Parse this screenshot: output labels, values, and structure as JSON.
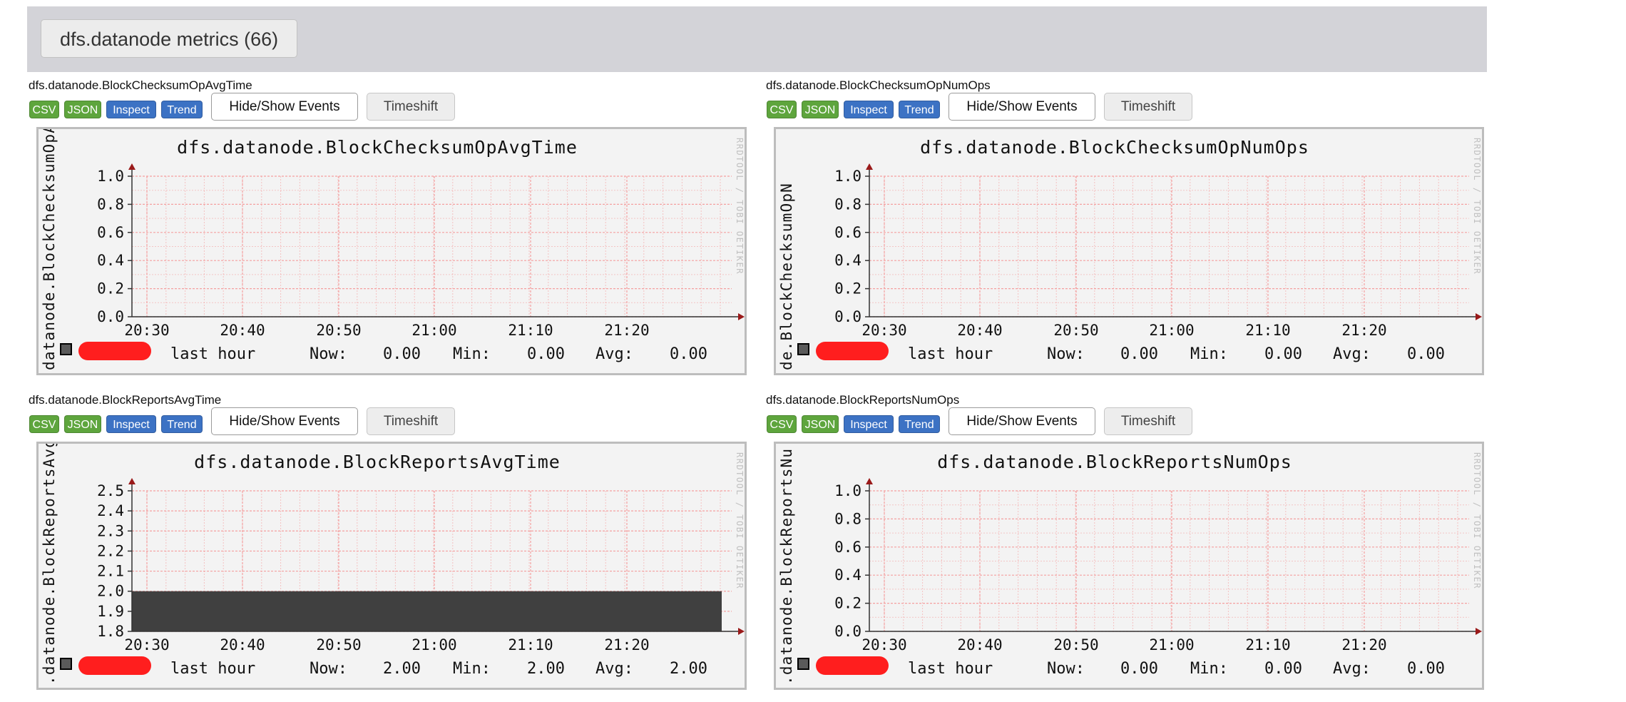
{
  "section": {
    "label": "dfs.datanode metrics (66)"
  },
  "buttons": {
    "csv": "CSV",
    "json": "JSON",
    "inspect": "Inspect",
    "trend": "Trend",
    "events": "Hide/Show Events",
    "timeshift": "Timeshift"
  },
  "footer": {
    "period": "last hour",
    "now_label": "Now:",
    "min_label": "Min:",
    "avg_label": "Avg:"
  },
  "watermark": "RRDTOOL / TOBI OETIKER",
  "colors": {
    "grid": "#f4a0a0",
    "axis": "#9a1a1a",
    "area": "#404040",
    "redaction": "#ff1e1e"
  },
  "panels": [
    {
      "metric": "dfs.datanode.BlockChecksumOpAvgTime",
      "ylabel": "datanode.BlockChecksumOpAv",
      "stats": {
        "now": "0.00",
        "min": "0.00",
        "avg": "0.00"
      },
      "chart_data": {
        "type": "area",
        "title": "dfs.datanode.BlockChecksumOpAvgTime",
        "x": [
          "20:30",
          "20:40",
          "20:50",
          "21:00",
          "21:10",
          "21:20"
        ],
        "ylim": [
          0,
          1.0
        ],
        "yticks": [
          "0.0",
          "0.2",
          "0.4",
          "0.6",
          "0.8",
          "1.0"
        ],
        "series": [
          {
            "values": []
          }
        ],
        "grid": true
      }
    },
    {
      "metric": "dfs.datanode.BlockChecksumOpNumOps",
      "ylabel": "de.BlockChecksumOpN",
      "stats": {
        "now": "0.00",
        "min": "0.00",
        "avg": "0.00"
      },
      "chart_data": {
        "type": "area",
        "title": "dfs.datanode.BlockChecksumOpNumOps",
        "x": [
          "20:30",
          "20:40",
          "20:50",
          "21:00",
          "21:10",
          "21:20"
        ],
        "ylim": [
          0,
          1.0
        ],
        "yticks": [
          "0.0",
          "0.2",
          "0.4",
          "0.6",
          "0.8",
          "1.0"
        ],
        "series": [
          {
            "values": []
          }
        ],
        "grid": true
      }
    },
    {
      "metric": "dfs.datanode.BlockReportsAvgTime",
      "ylabel": ".datanode.BlockReportsAvg",
      "stats": {
        "now": "2.00",
        "min": "2.00",
        "avg": "2.00"
      },
      "chart_data": {
        "type": "area",
        "title": "dfs.datanode.BlockReportsAvgTime",
        "x": [
          "20:30",
          "20:40",
          "20:50",
          "21:00",
          "21:10",
          "21:20"
        ],
        "ylim": [
          1.8,
          2.5
        ],
        "yticks": [
          "1.8",
          "1.9",
          "2.0",
          "2.1",
          "2.2",
          "2.3",
          "2.4",
          "2.5"
        ],
        "series": [
          {
            "values": [
              2.0,
              2.0,
              2.0,
              2.0,
              2.0,
              2.0
            ]
          }
        ],
        "grid": true
      }
    },
    {
      "metric": "dfs.datanode.BlockReportsNumOps",
      "ylabel": ".datanode.BlockReportsNu",
      "stats": {
        "now": "0.00",
        "min": "0.00",
        "avg": "0.00"
      },
      "chart_data": {
        "type": "area",
        "title": "dfs.datanode.BlockReportsNumOps",
        "x": [
          "20:30",
          "20:40",
          "20:50",
          "21:00",
          "21:10",
          "21:20"
        ],
        "ylim": [
          0,
          1.0
        ],
        "yticks": [
          "0.0",
          "0.2",
          "0.4",
          "0.6",
          "0.8",
          "1.0"
        ],
        "series": [
          {
            "values": []
          }
        ],
        "grid": true
      }
    }
  ]
}
